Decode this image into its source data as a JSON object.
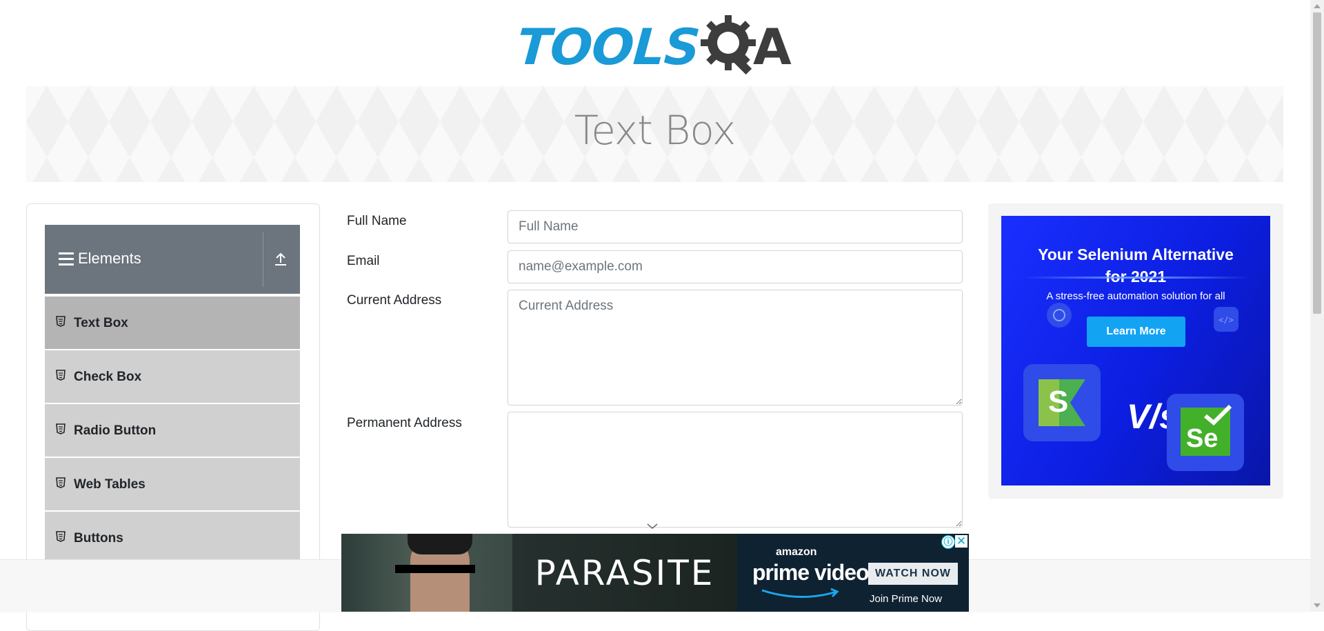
{
  "header": {
    "logo_text_left": "TOOLS",
    "logo_text_right": "A",
    "banner_title": "Text Box"
  },
  "sidebar": {
    "group_title": "Elements",
    "items": [
      {
        "label": "Text Box",
        "active": true
      },
      {
        "label": "Check Box",
        "active": false
      },
      {
        "label": "Radio Button",
        "active": false
      },
      {
        "label": "Web Tables",
        "active": false
      },
      {
        "label": "Buttons",
        "active": false
      }
    ]
  },
  "form": {
    "full_name": {
      "label": "Full Name",
      "placeholder": "Full Name",
      "value": ""
    },
    "email": {
      "label": "Email",
      "placeholder": "name@example.com",
      "value": ""
    },
    "current_address": {
      "label": "Current Address",
      "placeholder": "Current Address",
      "value": ""
    },
    "permanent_address": {
      "label": "Permanent Address",
      "placeholder": "",
      "value": ""
    }
  },
  "side_ad": {
    "headline_line1": "Your Selenium Alternative",
    "headline_line2": "for 2021",
    "subline": "A stress-free automation solution for all",
    "button_label": "Learn More",
    "vs_text": "V/s",
    "logo_left": "S",
    "logo_right": "Se"
  },
  "bottom_ad": {
    "title": "PARASITE",
    "brand_top": "amazon",
    "brand_main": "prime video",
    "cta": "WATCH NOW",
    "tagline": "Join Prime Now",
    "info_icon": "ⓘ",
    "close_icon": "✕"
  },
  "colors": {
    "brand_blue": "#1a9ad6",
    "group_header_bg": "#6c757d",
    "active_item_bg": "#b4b4b4",
    "item_bg": "#d0d0d0",
    "ad_button": "#13a3f3"
  }
}
